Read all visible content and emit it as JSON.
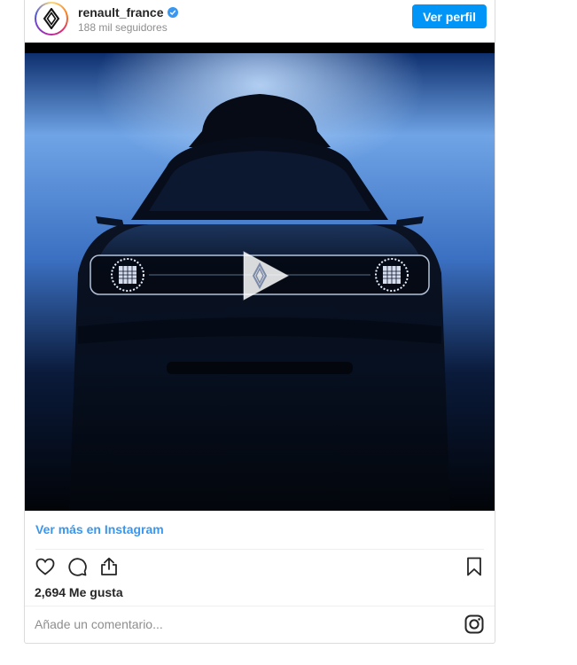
{
  "header": {
    "username": "renault_france",
    "followers": "188 mil seguidores",
    "view_profile_label": "Ver perfil",
    "verified": true
  },
  "media": {
    "type": "video",
    "play_icon": "play-icon"
  },
  "footer": {
    "more_on_instagram": "Ver más en Instagram",
    "likes": "2,694 Me gusta",
    "comment_placeholder": "Añade un comentario..."
  },
  "icons": {
    "like": "heart-icon",
    "comment": "comment-icon",
    "share": "share-icon",
    "save": "bookmark-icon",
    "instagram": "instagram-icon"
  },
  "colors": {
    "accent": "#0095f6",
    "link": "#3897f0",
    "muted": "#8e8e8e",
    "border": "#dbdbdb"
  }
}
